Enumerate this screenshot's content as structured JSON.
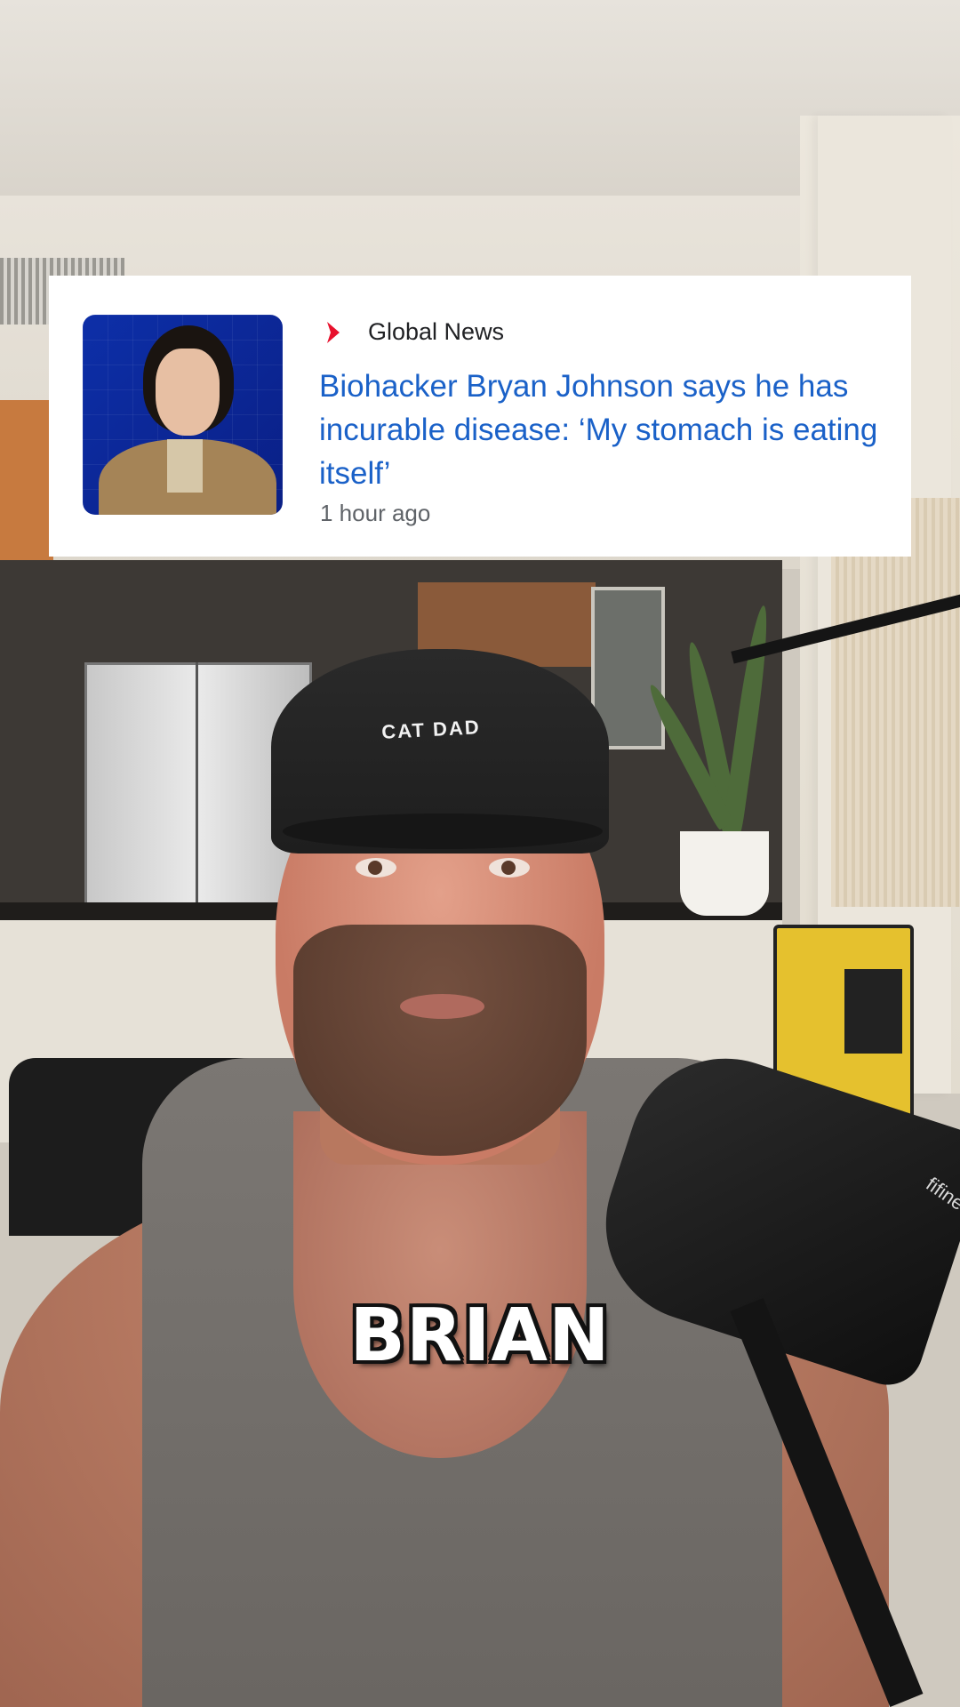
{
  "news_card": {
    "source": "Global News",
    "headline": "Biohacker Bryan Johnson says he has incurable disease: ‘My stomach is eating itself’",
    "timestamp": "1 hour ago",
    "accent_color": "#e8112d",
    "headline_color": "#1a61c8"
  },
  "scene": {
    "cap_text": "CAT DAD",
    "mic_brand": "fifine"
  },
  "caption": {
    "text": "BRIAN"
  }
}
